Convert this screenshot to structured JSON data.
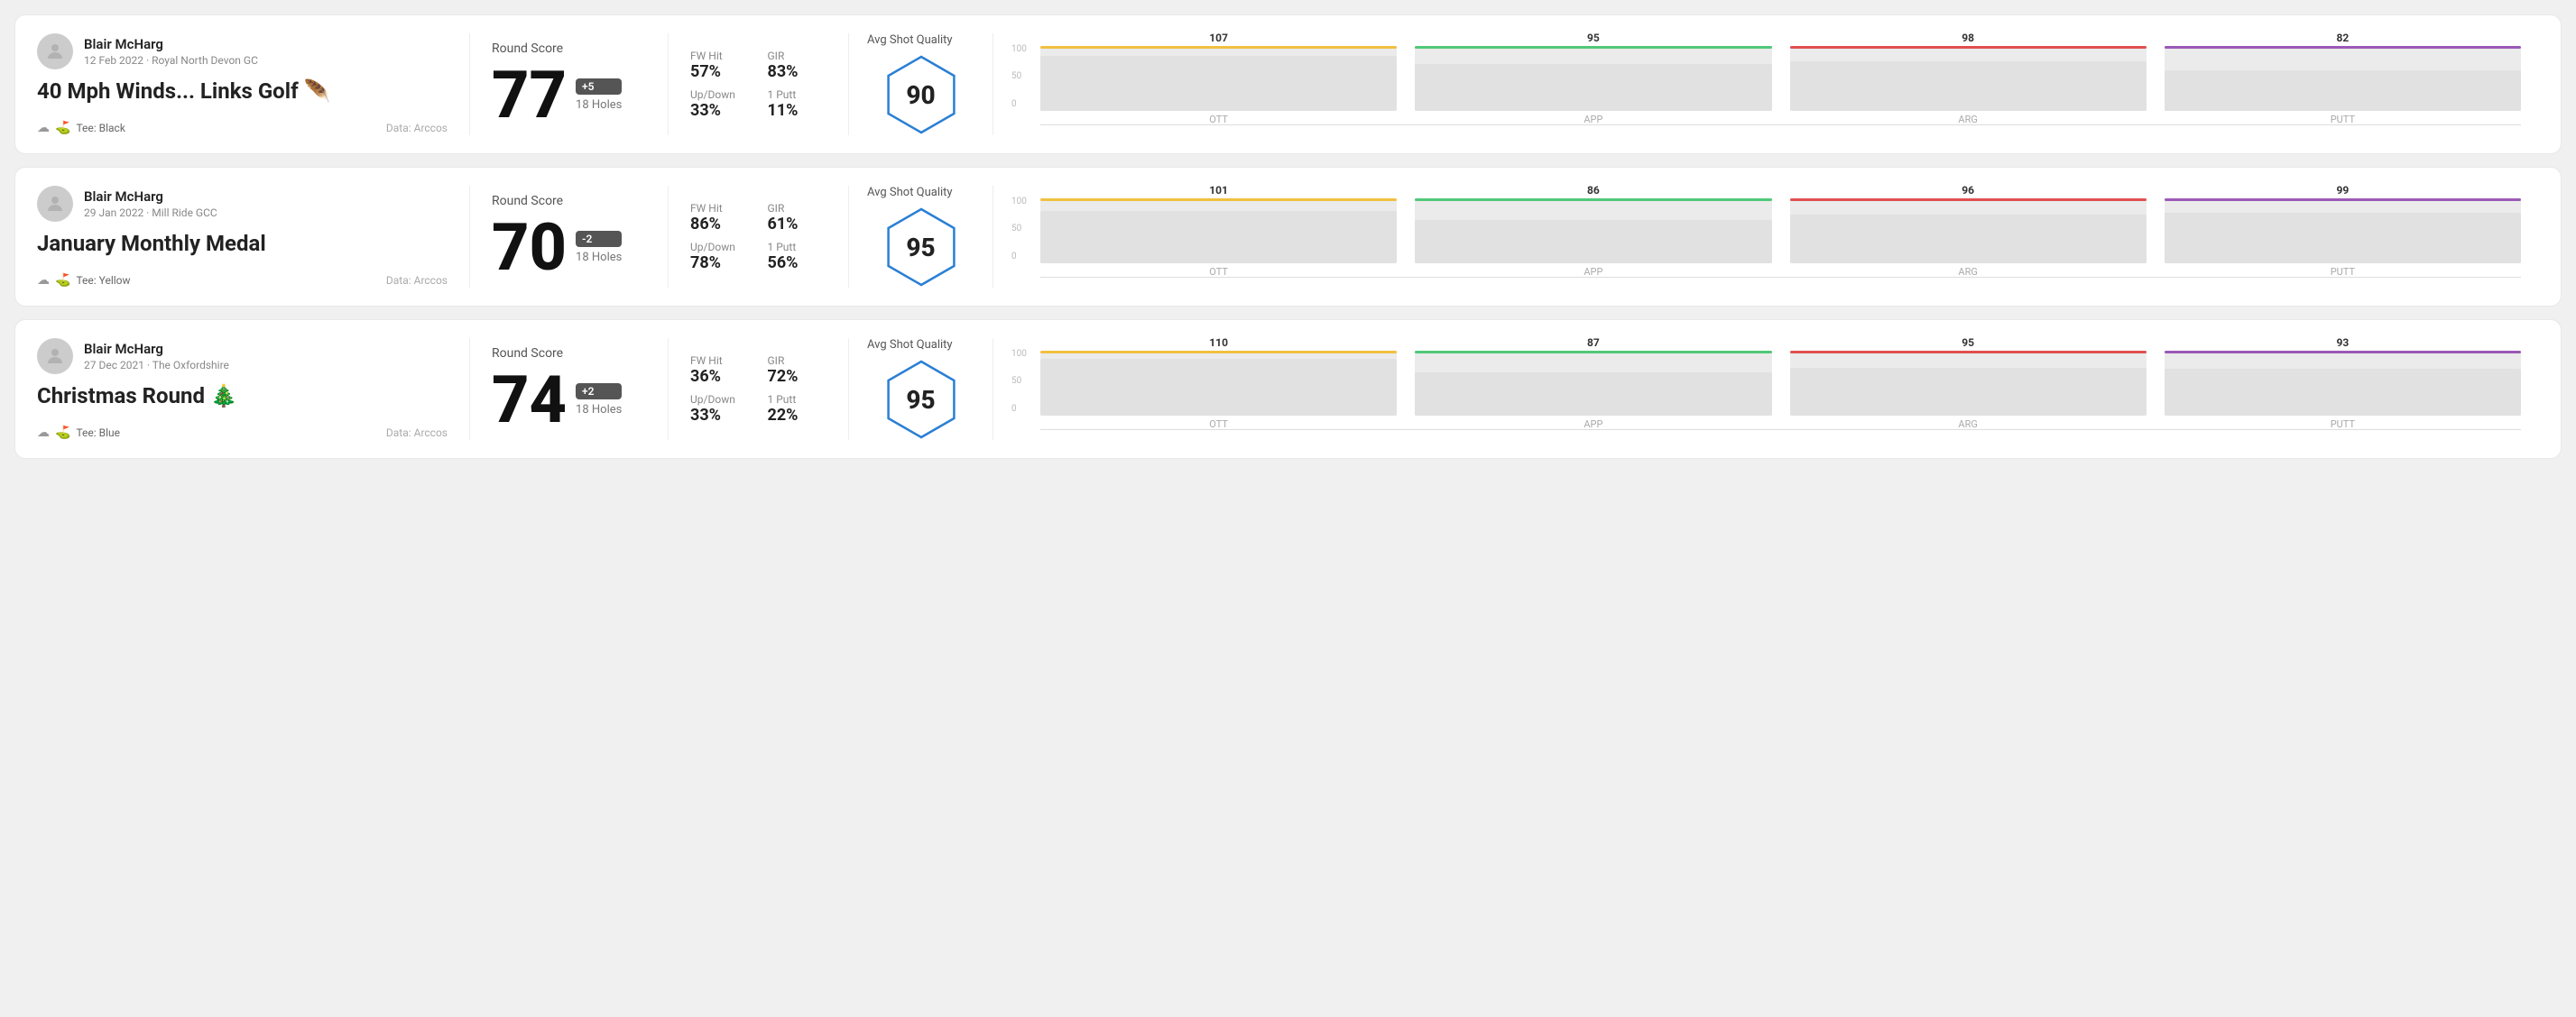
{
  "rounds": [
    {
      "id": "round1",
      "user_name": "Blair McHarg",
      "user_meta": "12 Feb 2022 · Royal North Devon GC",
      "round_title": "40 Mph Winds... Links Golf 🪶",
      "tee_color": "Black",
      "data_source": "Data: Arccos",
      "score": "77",
      "score_diff": "+5",
      "holes": "18 Holes",
      "fw_hit": "57%",
      "gir": "83%",
      "up_down": "33%",
      "one_putt": "11%",
      "avg_shot_quality": "90",
      "chart": {
        "bars": [
          {
            "label": "OTT",
            "value": 107,
            "color": "#f0c040",
            "fill_pct": 85
          },
          {
            "label": "APP",
            "value": 95,
            "color": "#50c878",
            "fill_pct": 72
          },
          {
            "label": "ARG",
            "value": 98,
            "color": "#e05050",
            "fill_pct": 76
          },
          {
            "label": "PUTT",
            "value": 82,
            "color": "#9b59b6",
            "fill_pct": 62
          }
        ],
        "y_labels": [
          "100",
          "50",
          "0"
        ]
      }
    },
    {
      "id": "round2",
      "user_name": "Blair McHarg",
      "user_meta": "29 Jan 2022 · Mill Ride GCC",
      "round_title": "January Monthly Medal",
      "tee_color": "Yellow",
      "data_source": "Data: Arccos",
      "score": "70",
      "score_diff": "-2",
      "holes": "18 Holes",
      "fw_hit": "86%",
      "gir": "61%",
      "up_down": "78%",
      "one_putt": "56%",
      "avg_shot_quality": "95",
      "chart": {
        "bars": [
          {
            "label": "OTT",
            "value": 101,
            "color": "#f0c040",
            "fill_pct": 80
          },
          {
            "label": "APP",
            "value": 86,
            "color": "#50c878",
            "fill_pct": 66
          },
          {
            "label": "ARG",
            "value": 96,
            "color": "#e05050",
            "fill_pct": 75
          },
          {
            "label": "PUTT",
            "value": 99,
            "color": "#9b59b6",
            "fill_pct": 78
          }
        ],
        "y_labels": [
          "100",
          "50",
          "0"
        ]
      }
    },
    {
      "id": "round3",
      "user_name": "Blair McHarg",
      "user_meta": "27 Dec 2021 · The Oxfordshire",
      "round_title": "Christmas Round 🎄",
      "tee_color": "Blue",
      "data_source": "Data: Arccos",
      "score": "74",
      "score_diff": "+2",
      "holes": "18 Holes",
      "fw_hit": "36%",
      "gir": "72%",
      "up_down": "33%",
      "one_putt": "22%",
      "avg_shot_quality": "95",
      "chart": {
        "bars": [
          {
            "label": "OTT",
            "value": 110,
            "color": "#f0c040",
            "fill_pct": 88
          },
          {
            "label": "APP",
            "value": 87,
            "color": "#50c878",
            "fill_pct": 67
          },
          {
            "label": "ARG",
            "value": 95,
            "color": "#e05050",
            "fill_pct": 74
          },
          {
            "label": "PUTT",
            "value": 93,
            "color": "#9b59b6",
            "fill_pct": 72
          }
        ],
        "y_labels": [
          "100",
          "50",
          "0"
        ]
      }
    }
  ],
  "labels": {
    "round_score": "Round Score",
    "fw_hit": "FW Hit",
    "gir": "GIR",
    "up_down": "Up/Down",
    "one_putt": "1 Putt",
    "avg_shot_quality": "Avg Shot Quality"
  }
}
